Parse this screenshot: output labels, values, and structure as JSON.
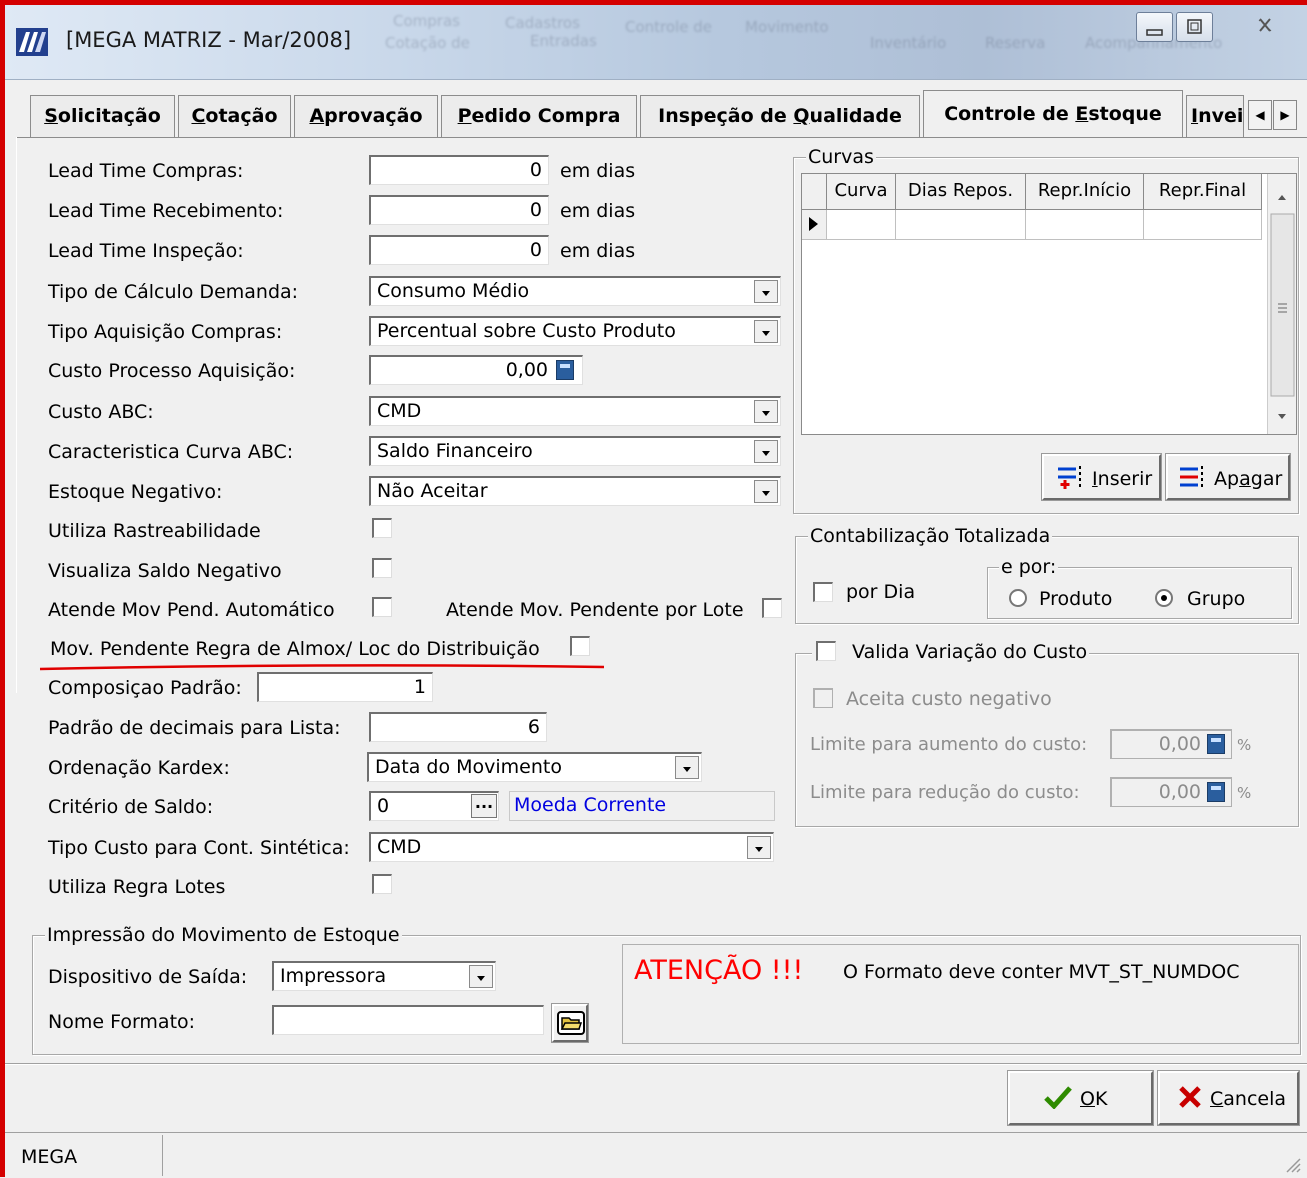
{
  "window": {
    "title": "[MEGA MATRIZ - Mar/2008]",
    "ghost_menu": [
      "Cadastros",
      "Compras",
      "Cotação de",
      "Entradas",
      "Controle de",
      "Movimento",
      "Inventário",
      "Reserva",
      "Acompanhamento"
    ]
  },
  "tabs": [
    {
      "pre": "",
      "key": "S",
      "post": "olicitação"
    },
    {
      "pre": "",
      "key": "C",
      "post": "otação"
    },
    {
      "pre": "",
      "key": "A",
      "post": "provação"
    },
    {
      "pre": "",
      "key": "P",
      "post": "edido Compra"
    },
    {
      "pre": "Inspeção de ",
      "key": "Q",
      "post": "ualidade"
    },
    {
      "pre": "Controle de ",
      "key": "E",
      "post": "stoque"
    },
    {
      "pre": "",
      "key": "I",
      "post": "nvei"
    }
  ],
  "form": {
    "lead_compras": {
      "label": "Lead Time Compras:",
      "value": "0",
      "unit": "em dias"
    },
    "lead_recebimento": {
      "label": "Lead Time Recebimento:",
      "value": "0",
      "unit": "em dias"
    },
    "lead_inspecao": {
      "label": "Lead Time Inspeção:",
      "value": "0",
      "unit": "em dias"
    },
    "tipo_calculo": {
      "label": "Tipo de Cálculo Demanda:",
      "value": "Consumo Médio"
    },
    "tipo_aquisicao": {
      "label": "Tipo Aquisição Compras:",
      "value": "Percentual sobre Custo Produto"
    },
    "custo_processo": {
      "label": "Custo Processo Aquisição:",
      "value": "0,00"
    },
    "custo_abc": {
      "label": "Custo ABC:",
      "value": "CMD"
    },
    "caracteristica_abc": {
      "label": "Caracteristica Curva ABC:",
      "value": "Saldo Financeiro"
    },
    "estoque_negativo": {
      "label": "Estoque Negativo:",
      "value": "Não Aceitar"
    },
    "rastreabilidade": {
      "label": "Utiliza Rastreabilidade"
    },
    "saldo_negativo": {
      "label": "Visualiza Saldo Negativo"
    },
    "atende_auto": {
      "label": "Atende Mov Pend. Automático"
    },
    "atende_lote": {
      "label": "Atende Mov. Pendente por Lote"
    },
    "regra_almox": {
      "label": "Mov. Pendente Regra de Almox/ Loc do Distribuição"
    },
    "composicao": {
      "label": "Composiçao Padrão:",
      "value": "1"
    },
    "decimais": {
      "label": "Padrão de decimais para Lista:",
      "value": "6"
    },
    "ordenacao": {
      "label": "Ordenação Kardex:",
      "value": "Data do Movimento"
    },
    "criterio": {
      "label": "Critério de Saldo:",
      "value": "0",
      "ellipsis": "...",
      "desc": "Moeda Corrente"
    },
    "tipo_custo": {
      "label": "Tipo Custo para Cont. Sintética:",
      "value": "CMD"
    },
    "regra_lotes": {
      "label": "Utiliza Regra Lotes"
    }
  },
  "curvas": {
    "title": "Curvas",
    "columns": [
      "Curva",
      "Dias Repos.",
      "Repr.Início",
      "Repr.Final"
    ],
    "inserir": {
      "key": "I",
      "rest": "nserir"
    },
    "apagar": {
      "pre": "Ap",
      "key": "a",
      "rest": "gar"
    }
  },
  "contab": {
    "title": "Contabilização Totalizada",
    "por_dia": "por Dia",
    "e_por": "e por:",
    "produto": "Produto",
    "grupo": "Grupo"
  },
  "variacao": {
    "title": "Valida Variação do Custo",
    "negativo": "Aceita custo negativo",
    "aumento_label": "Limite para aumento do custo:",
    "aumento_value": "0,00",
    "reducao_label": "Limite para redução do custo:",
    "reducao_value": "0,00",
    "pct": "%"
  },
  "impressao": {
    "title": "Impressão do Movimento de Estoque",
    "dispositivo_label": "Dispositivo de Saída:",
    "dispositivo_value": "Impressora",
    "nome_label": "Nome Formato:",
    "nome_value": "",
    "atencao": "ATENÇÃO !!!",
    "aviso": "O Formato deve conter MVT_ST_NUMDOC"
  },
  "buttons": {
    "ok": {
      "key": "O",
      "rest": "K"
    },
    "cancela": {
      "key": "C",
      "rest": "ancela"
    }
  },
  "status": {
    "text": "MEGA"
  },
  "colors": {
    "annotation": "#e00000",
    "link_blue": "#0000e0",
    "warning_red": "#ff0000",
    "check_green": "#2e8b00",
    "cross_red": "#c80000"
  }
}
